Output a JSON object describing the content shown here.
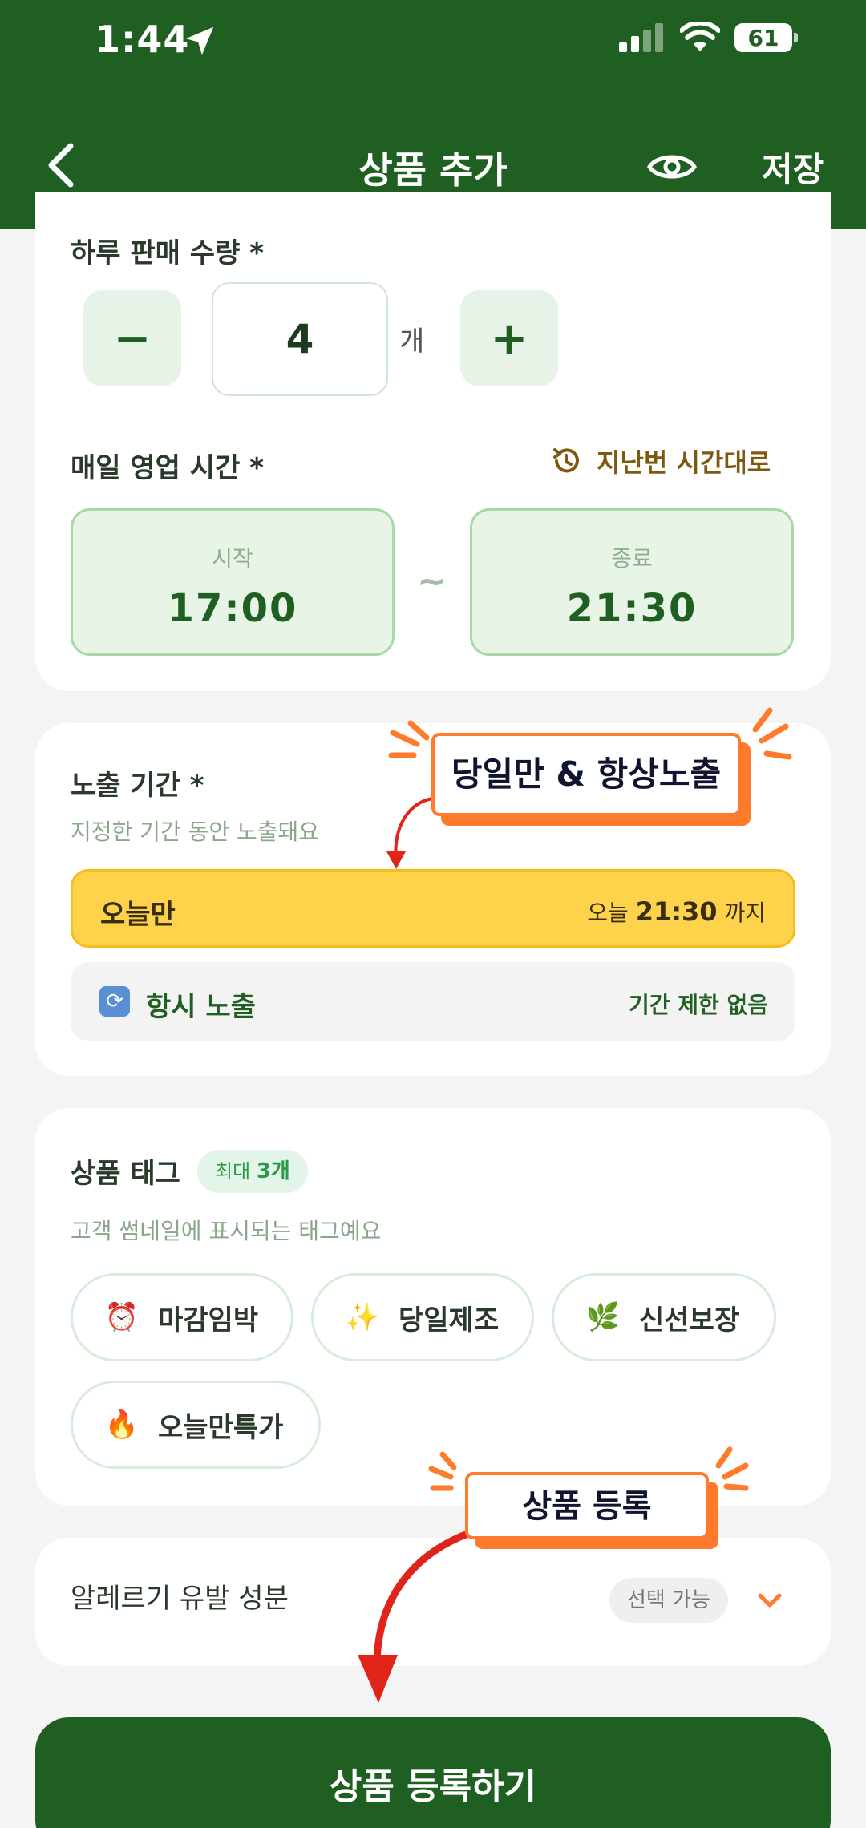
{
  "status_bar": {
    "time": "1:44",
    "battery": "61"
  },
  "header": {
    "title": "상품 추가",
    "save_label": "저장"
  },
  "quantity": {
    "label": "하루 판매 수량 *",
    "value": "4",
    "unit": "개",
    "minus": "−",
    "plus": "+"
  },
  "hours": {
    "label": "매일 영업 시간 *",
    "previous_label": "지난번 시간대로",
    "start_caption": "시작",
    "start_value": "17:00",
    "separator": "~",
    "end_caption": "종료",
    "end_value": "21:30"
  },
  "exposure": {
    "label": "노출 기간 *",
    "description": "지정한 기간 동안 노출돼요",
    "today_label": "오늘만",
    "today_prefix": "오늘",
    "today_time": "21:30",
    "today_suffix": "까지",
    "always_label": "항시 노출",
    "always_note": "기간 제한 없음"
  },
  "tags": {
    "label": "상품 태그",
    "max_prefix": "최대",
    "max_count": "3개",
    "description": "고객 썸네일에 표시되는 태그예요",
    "items": [
      {
        "emoji": "⏰",
        "label": "마감임박"
      },
      {
        "emoji": "✨",
        "label": "당일제조"
      },
      {
        "emoji": "🌿",
        "label": "신선보장"
      },
      {
        "emoji": "🔥",
        "label": "오늘만특가"
      }
    ]
  },
  "allergy": {
    "label": "알레르기 유발 성분",
    "pill": "선택 가능"
  },
  "submit_label": "상품 등록하기",
  "callouts": {
    "first": "당일만 & 항상노출",
    "second": "상품 등록"
  },
  "colors": {
    "header": "#1f5f22",
    "today_option": "#ffd24c",
    "callout": "#ff7a2a"
  }
}
